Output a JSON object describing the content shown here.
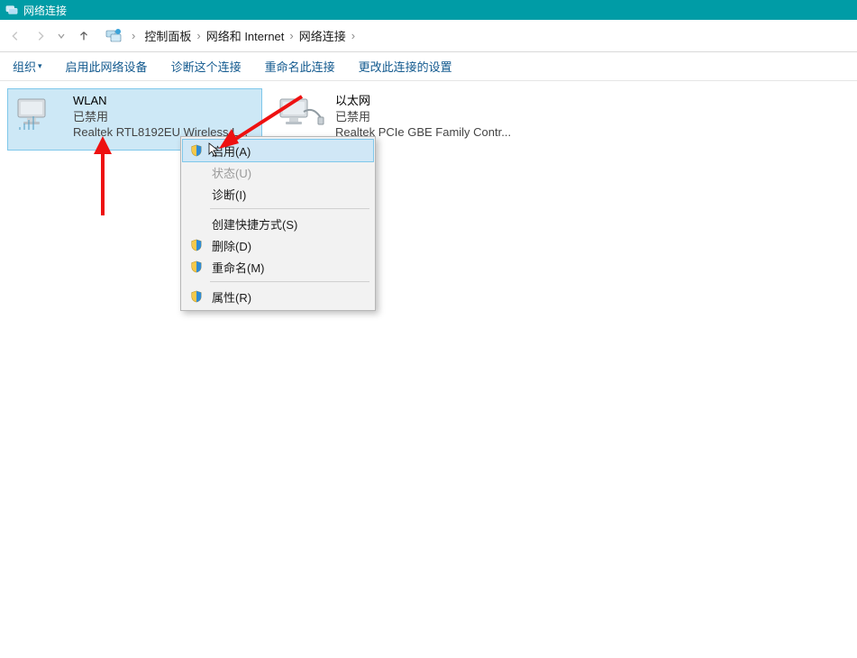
{
  "window": {
    "title": "网络连接"
  },
  "breadcrumb": {
    "items": [
      "控制面板",
      "网络和 Internet",
      "网络连接"
    ]
  },
  "toolbar": {
    "organize": "组织",
    "enable_device": "启用此网络设备",
    "diagnose": "诊断这个连接",
    "rename": "重命名此连接",
    "change_settings": "更改此连接的设置"
  },
  "adapters": [
    {
      "name": "WLAN",
      "status": "已禁用",
      "device": "Realtek RTL8192EU Wireless L...",
      "selected": true
    },
    {
      "name": "以太网",
      "status": "已禁用",
      "device": "Realtek PCIe GBE Family Contr...",
      "selected": false
    }
  ],
  "context_menu": {
    "items": [
      {
        "label": "启用(A)",
        "shield": true,
        "state": "hover"
      },
      {
        "label": "状态(U)",
        "shield": false,
        "state": "disabled"
      },
      {
        "label": "诊断(I)",
        "shield": false,
        "state": "normal"
      },
      {
        "sep": true
      },
      {
        "label": "创建快捷方式(S)",
        "shield": false,
        "state": "normal"
      },
      {
        "label": "删除(D)",
        "shield": true,
        "state": "normal"
      },
      {
        "label": "重命名(M)",
        "shield": true,
        "state": "normal"
      },
      {
        "sep": true
      },
      {
        "label": "属性(R)",
        "shield": true,
        "state": "normal"
      }
    ]
  }
}
